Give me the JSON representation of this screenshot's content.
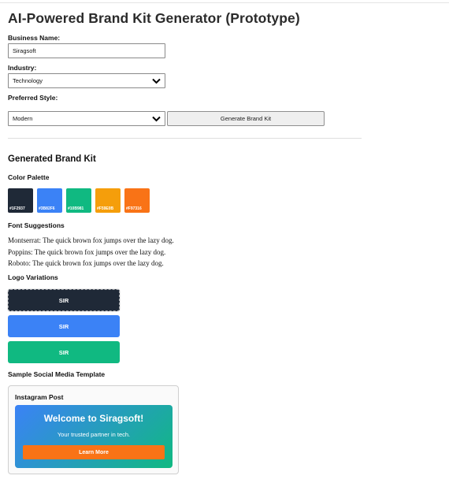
{
  "app": {
    "title": "AI-Powered Brand Kit Generator (Prototype)"
  },
  "form": {
    "business_name_label": "Business Name:",
    "business_name_value": "Siragsoft",
    "industry_label": "Industry:",
    "industry_value": "Technology",
    "style_label": "Preferred Style:",
    "style_value": "Modern",
    "generate_button": "Generate Brand Kit"
  },
  "kit": {
    "heading": "Generated Brand Kit",
    "palette_heading": "Color Palette",
    "palette": [
      {
        "hex": "#1F2937",
        "label": "#1F2937"
      },
      {
        "hex": "#3B82F6",
        "label": "#3B82F6"
      },
      {
        "hex": "#10B981",
        "label": "#10B981"
      },
      {
        "hex": "#F59E0B",
        "label": "#F59E0B"
      },
      {
        "hex": "#F97316",
        "label": "#F97316"
      }
    ],
    "fonts_heading": "Font Suggestions",
    "fonts": [
      "Montserrat: The quick brown fox jumps over the lazy dog.",
      "Poppins: The quick brown fox jumps over the lazy dog.",
      "Roboto: The quick brown fox jumps over the lazy dog."
    ],
    "logo_heading": "Logo Variations",
    "logos": [
      {
        "text": "SIR",
        "color": "#1F2937"
      },
      {
        "text": "SIR",
        "color": "#3B82F6"
      },
      {
        "text": "SIR",
        "color": "#10B981"
      }
    ],
    "social_heading": "Sample Social Media Template",
    "social": {
      "card_title": "Instagram Post",
      "headline": "Welcome to Siragsoft!",
      "subtext": "Your trusted partner in tech.",
      "cta": "Learn More",
      "gradient_start": "#3B82F6",
      "gradient_end": "#10B981",
      "cta_color": "#F97316"
    }
  }
}
